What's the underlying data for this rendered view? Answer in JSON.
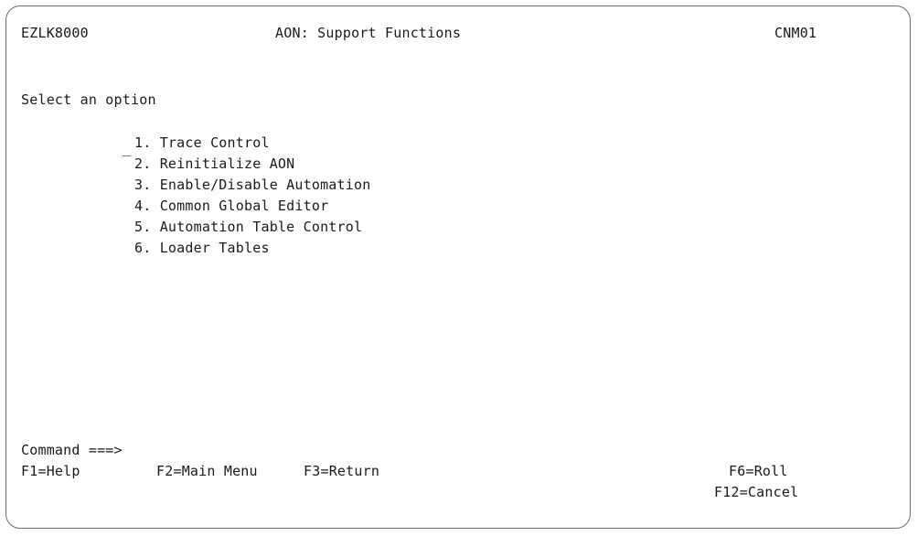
{
  "header": {
    "panel_id": "EZLK8000",
    "title": "AON: Support Functions",
    "system_id": "CNM01"
  },
  "prompt": "Select an option",
  "selection_field": {
    "value": "_"
  },
  "menu": {
    "items": [
      {
        "label": "1. Trace Control"
      },
      {
        "label": "2. Reinitialize AON"
      },
      {
        "label": "3. Enable/Disable Automation"
      },
      {
        "label": "4. Common Global Editor"
      },
      {
        "label": "5. Automation Table Control"
      },
      {
        "label": "6. Loader Tables"
      }
    ]
  },
  "command": {
    "label": "Command ===>",
    "value": ""
  },
  "function_keys": {
    "f1": "F1=Help",
    "f2": "F2=Main Menu",
    "f3": "F3=Return",
    "f6": "F6=Roll",
    "f12": "F12=Cancel"
  }
}
